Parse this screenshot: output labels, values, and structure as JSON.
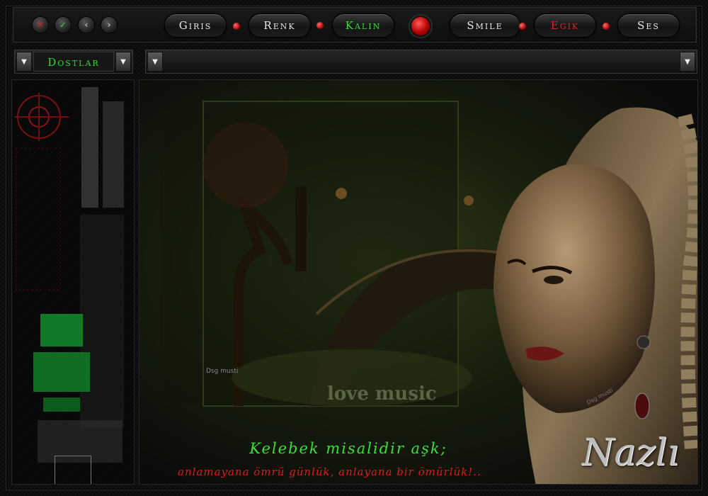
{
  "toolbar": {
    "window_controls": [
      {
        "icon": "close-icon",
        "color": "#d02323"
      },
      {
        "icon": "check-icon",
        "color": "#3fd03a"
      },
      {
        "icon": "chevron-left-icon"
      },
      {
        "icon": "chevron-right-icon"
      }
    ],
    "buttons": {
      "giris": "Giris",
      "renk": "Renk",
      "kalin": "Kalın",
      "smile": "Smile",
      "egik": "Egik",
      "ses": "Ses"
    },
    "accent_colors": {
      "kalin": "#3adf3a",
      "egik": "#e02424",
      "orb": "#d00000"
    }
  },
  "dropdowns": {
    "left": {
      "selected": "Dostlar"
    },
    "right": {
      "selected": ""
    }
  },
  "main": {
    "verse_line1": "Kelebek misalidir aşk;",
    "verse_line2": "anlamayana ömrü günlük, anlayana bir ömürlük!..",
    "signature": "Nazlı",
    "watermark_small": "Dsg musti",
    "watermark_love": "love music"
  }
}
